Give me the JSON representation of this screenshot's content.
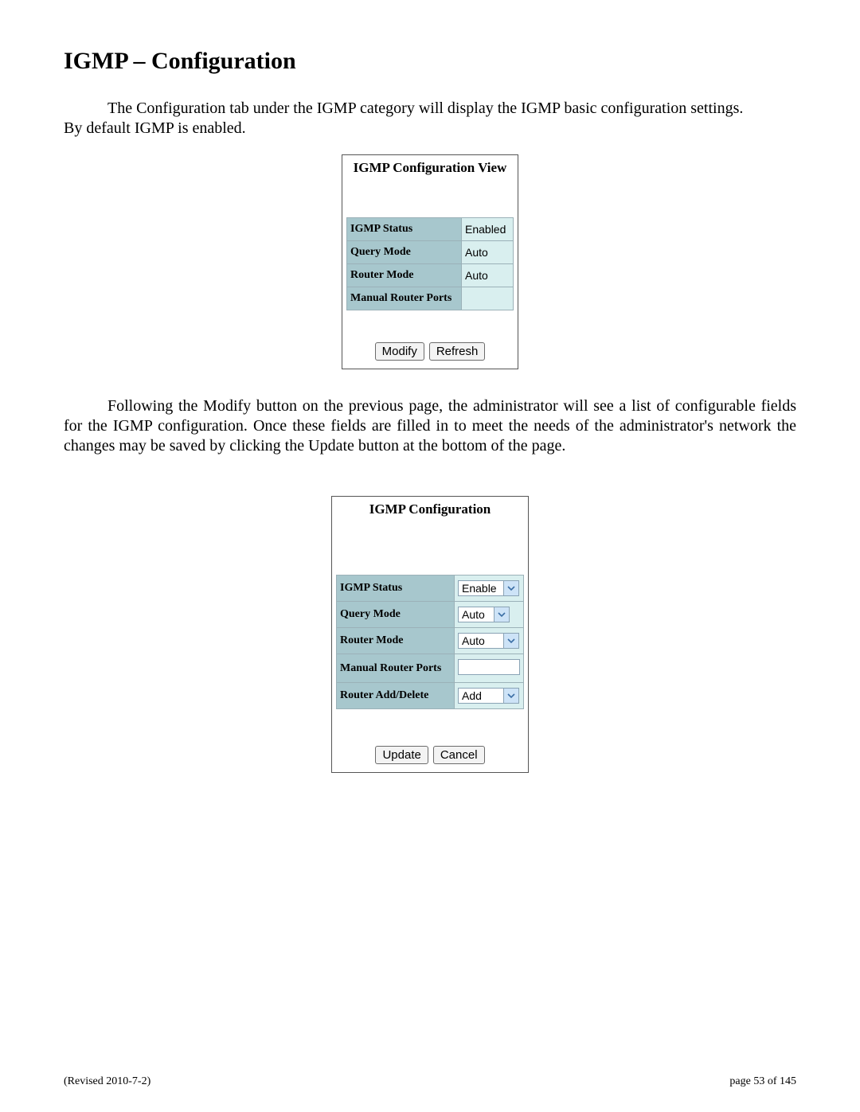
{
  "title": "IGMP – Configuration",
  "para1_a": "The Configuration tab under the IGMP category will display the IGMP basic configuration settings.",
  "para1_b": "By default IGMP is enabled.",
  "para2": "Following the Modify button on the previous page, the administrator will see a list of configurable fields for the IGMP configuration.  Once these fields are filled in to meet the needs of the administrator's network the changes may be saved by clicking the Update button at the bottom of the page.",
  "view_panel": {
    "title": "IGMP Configuration View",
    "rows": [
      {
        "label": "IGMP Status",
        "value": "Enabled"
      },
      {
        "label": "Query Mode",
        "value": "Auto"
      },
      {
        "label": "Router Mode",
        "value": "Auto"
      },
      {
        "label": "Manual Router Ports",
        "value": ""
      }
    ],
    "buttons": {
      "modify": "Modify",
      "refresh": "Refresh"
    }
  },
  "config_panel": {
    "title": "IGMP Configuration",
    "rows": {
      "igmp_status": {
        "label": "IGMP Status",
        "type": "select",
        "value": "Enable",
        "wide": true
      },
      "query_mode": {
        "label": "Query Mode",
        "type": "select",
        "value": "Auto",
        "wide": false
      },
      "router_mode": {
        "label": "Router Mode",
        "type": "select",
        "value": "Auto",
        "wide": true
      },
      "manual_ports": {
        "label": "Manual Router Ports",
        "type": "text",
        "value": ""
      },
      "router_add": {
        "label": "Router Add/Delete",
        "type": "select",
        "value": "Add",
        "wide": true
      }
    },
    "buttons": {
      "update": "Update",
      "cancel": "Cancel"
    }
  },
  "footer": {
    "revised": "(Revised 2010-7-2)",
    "page": "page 53 of 145"
  }
}
